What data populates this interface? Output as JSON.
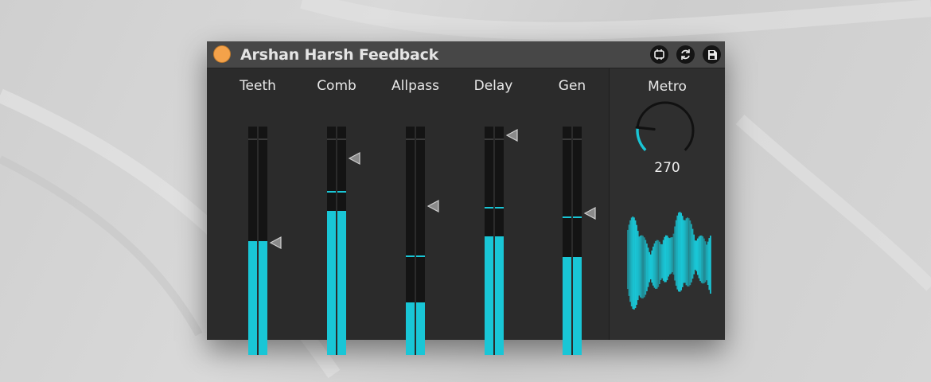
{
  "device": {
    "title": "Arshan Harsh Feedback",
    "power_state": "on",
    "icons": [
      "link-icon",
      "refresh-icon",
      "save-icon"
    ]
  },
  "colors": {
    "accent": "#19c6d6",
    "power": "#f4a24a",
    "panel": "#2b2b2b",
    "titlebar": "#474747"
  },
  "meters": [
    {
      "label": "Teeth",
      "level": 0.49,
      "peak": 0.49,
      "slider": 0.49
    },
    {
      "label": "Comb",
      "level": 0.63,
      "peak": 0.71,
      "slider": 0.86
    },
    {
      "label": "Allpass",
      "level": 0.23,
      "peak": 0.43,
      "slider": 0.65
    },
    {
      "label": "Delay",
      "level": 0.52,
      "peak": 0.64,
      "slider": 0.96
    },
    {
      "label": "Gen",
      "level": 0.43,
      "peak": 0.6,
      "slider": 0.62
    }
  ],
  "metro": {
    "label": "Metro",
    "value": "270",
    "knob_fraction": 0.19
  }
}
